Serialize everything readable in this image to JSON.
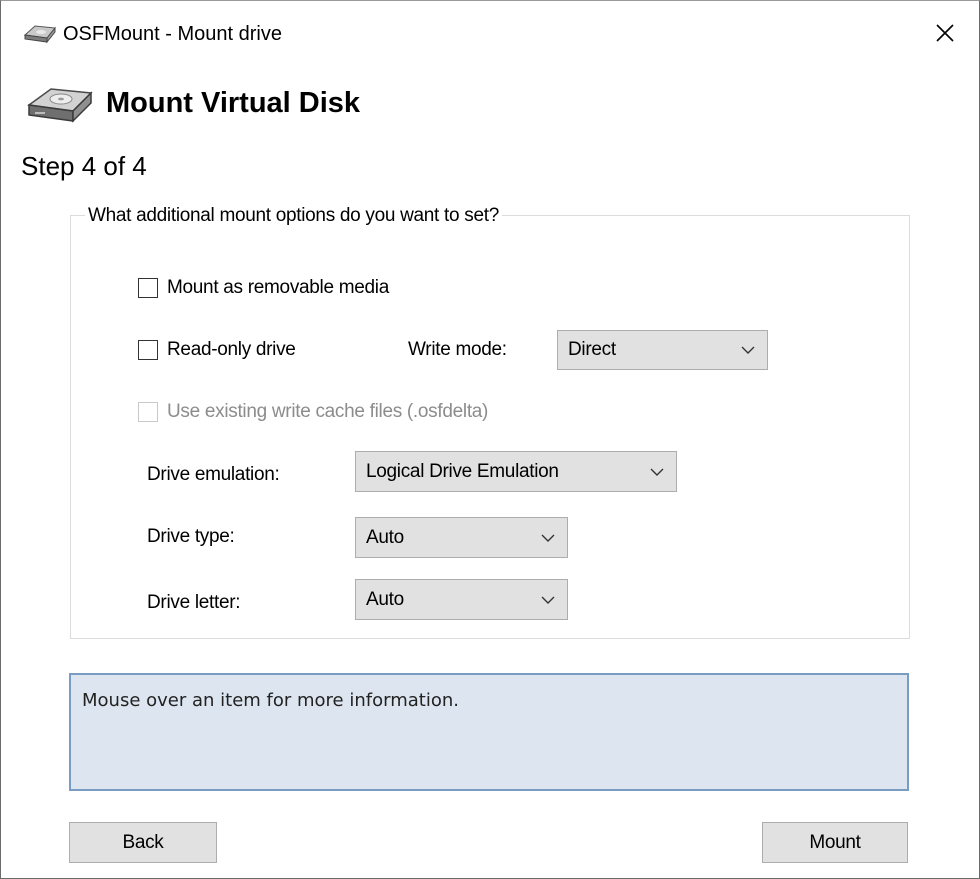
{
  "window": {
    "title": "OSFMount - Mount drive",
    "app_icon": "disk-drive-icon",
    "close_icon": "close-icon"
  },
  "header": {
    "title": "Mount Virtual Disk",
    "icon": "disk-drive-icon"
  },
  "step": {
    "label": "Step 4 of 4"
  },
  "options": {
    "group_title": "What additional mount options do you want to set?",
    "removable_media": {
      "label": "Mount as removable media",
      "checked": false
    },
    "read_only": {
      "label": "Read-only drive",
      "checked": false
    },
    "write_mode": {
      "label": "Write mode:",
      "value": "Direct"
    },
    "write_cache": {
      "label": "Use existing write cache files (.osfdelta)",
      "checked": false,
      "enabled": false
    },
    "drive_emulation": {
      "label": "Drive emulation:",
      "value": "Logical Drive Emulation"
    },
    "drive_type": {
      "label": "Drive type:",
      "value": "Auto"
    },
    "drive_letter": {
      "label": "Drive letter:",
      "value": "Auto"
    }
  },
  "info": {
    "text": "Mouse over an item for more information."
  },
  "buttons": {
    "back": "Back",
    "mount": "Mount"
  },
  "colors": {
    "info_background": "#dde6f0",
    "info_border": "#7a9cc2",
    "button_face": "#e1e1e1"
  }
}
